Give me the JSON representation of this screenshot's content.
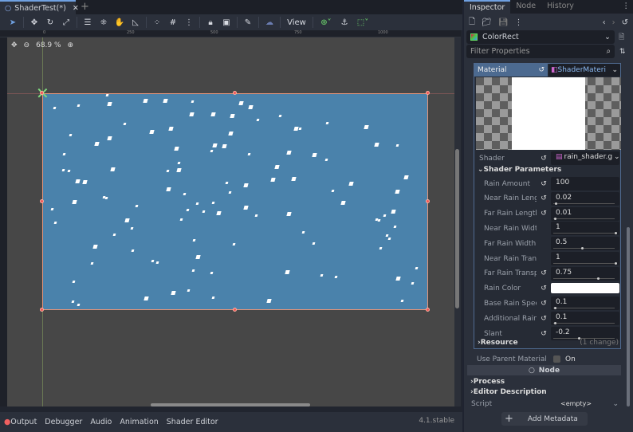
{
  "editor": {
    "scene_tab": "ShaderTest(*)",
    "add_tab": "+",
    "toolbar": {
      "view_label": "View"
    },
    "ruler_ticks": [
      "0",
      "250",
      "500",
      "750",
      "1000"
    ],
    "zoom_level": "68.9 %"
  },
  "bottom_panel": {
    "tabs": [
      "Output",
      "Debugger",
      "Audio",
      "Animation",
      "Shader Editor"
    ],
    "version": "4.1.stable"
  },
  "inspector": {
    "tabs": [
      "Inspector",
      "Node",
      "History"
    ],
    "node_name": "ColorRect",
    "filter_placeholder": "Filter Properties",
    "material": {
      "label": "Material",
      "value": "ShaderMateri",
      "shader_label": "Shader",
      "shader_value": "rain_shader.g"
    },
    "shader_parameters": {
      "title": "Shader Parameters",
      "params": [
        {
          "label": "Rain Amount",
          "value": "100",
          "reset": true,
          "slider": null
        },
        {
          "label": "Near Rain Length",
          "value": "0.02",
          "reset": true,
          "slider": 0.02
        },
        {
          "label": "Far Rain Length",
          "value": "0.01",
          "reset": true,
          "slider": 0.01
        },
        {
          "label": "Near Rain Width",
          "value": "1",
          "reset": false,
          "slider": 1
        },
        {
          "label": "Far Rain Width",
          "value": "0.5",
          "reset": false,
          "slider": 0.45
        },
        {
          "label": "Near Rain Transp...",
          "value": "1",
          "reset": false,
          "slider": 1
        },
        {
          "label": "Far Rain Transp...",
          "value": "0.75",
          "reset": true,
          "slider": 0.72
        },
        {
          "label": "Rain Color",
          "value": "",
          "reset": true,
          "color": "#ffffff"
        },
        {
          "label": "Base Rain Speed",
          "value": "0.1",
          "reset": true,
          "slider": 0.01
        },
        {
          "label": "Additional Rain ...",
          "value": "0.1",
          "reset": true,
          "slider": 0.01
        },
        {
          "label": "Slant",
          "value": "-0.2",
          "reset": true,
          "slider": 0.4
        }
      ]
    },
    "resource": {
      "label": "Resource",
      "changes": "(1 change)"
    },
    "use_parent_material": {
      "label": "Use Parent Material",
      "value": "On"
    },
    "node_section": "Node",
    "process": "Process",
    "editor_description": "Editor Description",
    "script": {
      "label": "Script",
      "value": "<empty>"
    },
    "add_metadata": "Add Metadata"
  },
  "colors": {
    "accent": "#6fa0e0",
    "rect": "#4a82ab"
  }
}
